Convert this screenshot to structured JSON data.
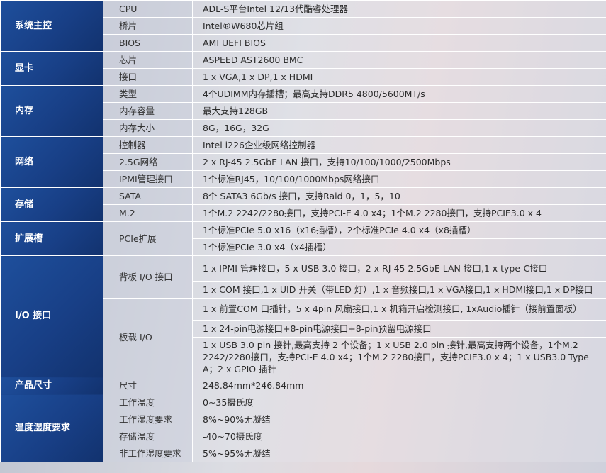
{
  "rows": {
    "cpu": {
      "cat": "系统主控",
      "sub": "CPU",
      "val": "ADL-S平台Intel 12/13代酷睿处理器"
    },
    "bridge": {
      "sub": "桥片",
      "val": "Intel®W680芯片组"
    },
    "bios": {
      "sub": "BIOS",
      "val": "AMI UEFI BIOS"
    },
    "gpu_chip": {
      "cat": "显卡",
      "sub": "芯片",
      "val": "ASPEED AST2600 BMC"
    },
    "gpu_port": {
      "sub": "接口",
      "val": "1 x VGA,1 x DP,1 x HDMI"
    },
    "mem_type": {
      "cat": "内存",
      "sub": "类型",
      "val": "4个UDIMM内存插槽；最高支持DDR5 4800/5600MT/s"
    },
    "mem_cap": {
      "sub": "内存容量",
      "val": "最大支持128GB"
    },
    "mem_size": {
      "sub": "内存大小",
      "val": "8G，16G，32G"
    },
    "net_ctrl": {
      "cat": "网络",
      "sub": "控制器",
      "val": "Intel  i226企业级网络控制器"
    },
    "net_25g": {
      "sub": "2.5G网络",
      "val": "2 x RJ-45 2.5GbE LAN 接口，支持10/100/1000/2500Mbps"
    },
    "net_ipmi": {
      "sub": "IPMI管理接口",
      "val": "1个标准RJ45，10/100/1000Mbps网络接口"
    },
    "sto_sata": {
      "cat": "存储",
      "sub": "SATA",
      "val": "8个 SATA3 6Gb/s 接口，支持Raid 0，1，5，10"
    },
    "sto_m2": {
      "sub": "M.2",
      "val": "1个M.2 2242/2280接口，支持PCI-E 4.0 x4；1个M.2 2280接口，支持PCIE3.0 x 4"
    },
    "exp": {
      "cat": "扩展槽",
      "sub": "PCIe扩展",
      "val1": "1个标准PCIe 5.0 x16（x16插槽），2个标准PCIe 4.0 x4（x8插槽）",
      "val2": "1个标准PCIe 3.0 x4（x4插槽）"
    },
    "io": {
      "cat": "I/O 接口",
      "rear_sub": "背板 I/O 接口",
      "rear1": "1 x IPMI 管理接口，5 x USB 3.0 接口，2 x RJ-45 2.5GbE LAN 接口,1 x type-C接口",
      "rear2": "1 x COM 接口,1 x UID 开关（带LED 灯）,1 x 音频接口,1 x VGA接口,1 x HDMI接口,1 x DP接口",
      "board_sub": "板载 I/O",
      "board1": "1 x 前置COM 口插针，5 x  4pin 风扇接口,1 x 机箱开启检测接口, 1xAudio插针（接前置面板）",
      "board2": "1 x 24-pin电源接口+8-pin电源接口+8-pin预留电源接口",
      "board3": "1 x USB 3.0 pin 接针,最高支持 2 个设备；1 x USB 2.0 pin 接针,最高支持两个设备，1个M.2 2242/2280接口，支持PCI-E 4.0 x4；1个M.2 2280接口，支持PCIE3.0 x 4；1 x USB3.0 Type A；2 x GPIO 插针"
    },
    "size": {
      "cat": "产品尺寸",
      "sub": "尺寸",
      "val": "248.84mm*246.84mm"
    },
    "env": {
      "cat": "温度湿度要求",
      "t_work_sub": "工作温度",
      "t_work": "0~35摄氏度",
      "h_work_sub": "工作湿度要求",
      "h_work": "8%~90%无凝结",
      "t_store_sub": "存储温度",
      "t_store": "-40~70摄氏度",
      "h_idle_sub": "非工作湿度要求",
      "h_idle": "5%~95%无凝结"
    }
  }
}
